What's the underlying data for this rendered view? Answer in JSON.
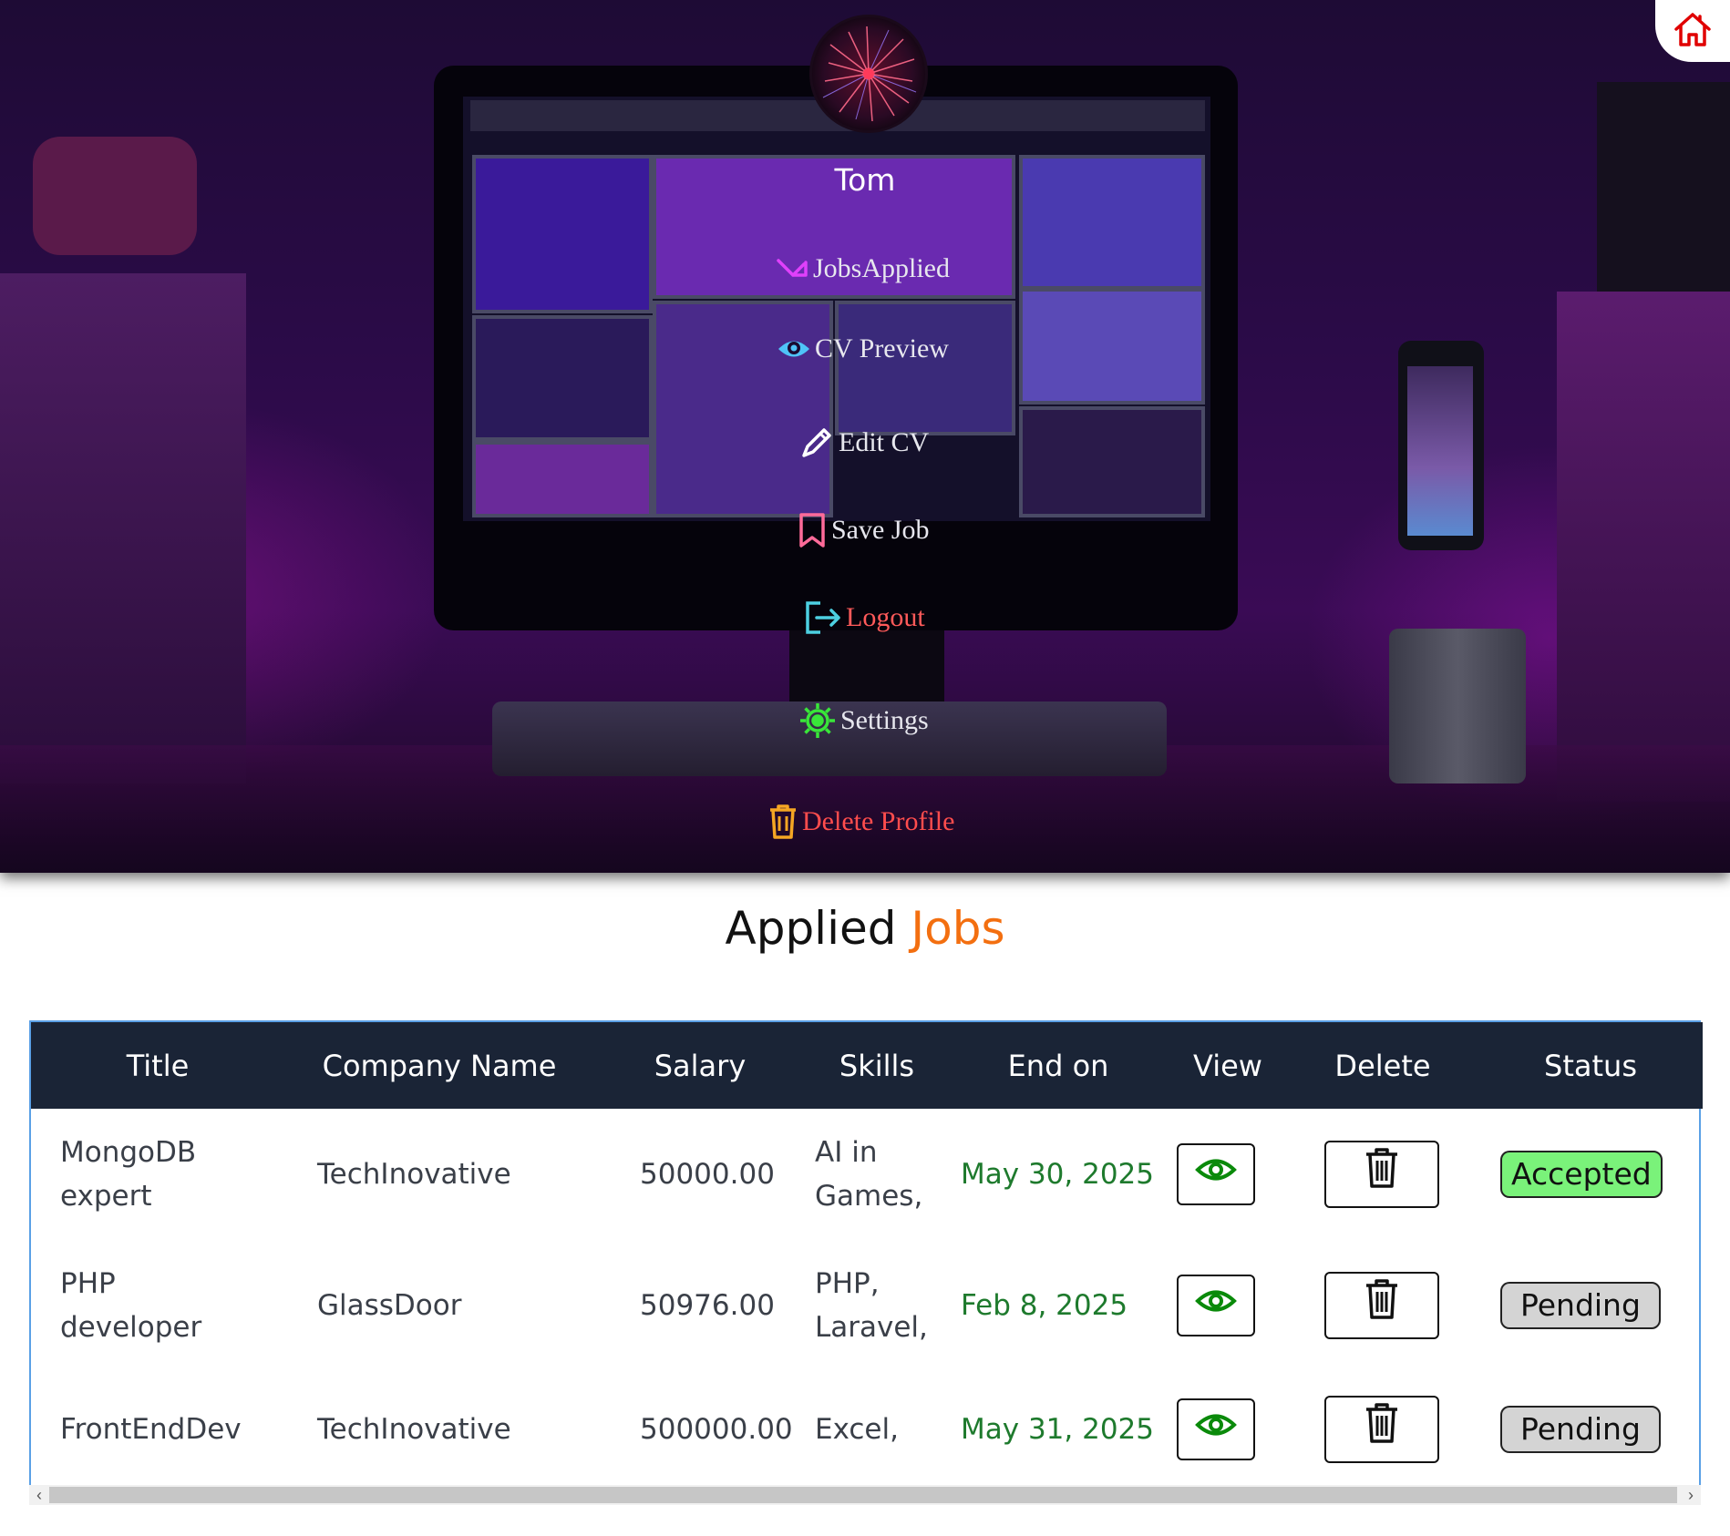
{
  "profile": {
    "name": "Tom"
  },
  "nav": {
    "jobs_applied": "JobsApplied",
    "cv_preview": "CV Preview",
    "edit_cv": "Edit CV",
    "save_job": "Save Job",
    "logout": "Logout",
    "settings": "Settings",
    "delete_profile": "Delete Profile"
  },
  "page": {
    "title_main": "Applied",
    "title_accent": "Jobs"
  },
  "table": {
    "headers": [
      "Title",
      "Company Name",
      "Salary",
      "Skills",
      "End on",
      "View",
      "Delete",
      "Status"
    ],
    "rows": [
      {
        "title": "MongoDB expert",
        "company": "TechInovative",
        "salary": "50000.00",
        "skills": "AI in Games,",
        "end_on": "May 30, 2025",
        "status": "Accepted"
      },
      {
        "title": "PHP developer",
        "company": "GlassDoor",
        "salary": "50976.00",
        "skills": "PHP, Laravel,",
        "end_on": "Feb 8, 2025",
        "status": "Pending"
      },
      {
        "title": "FrontEndDev",
        "company": "TechInovative",
        "salary": "500000.00",
        "skills": "Excel,",
        "end_on": "May 31, 2025",
        "status": "Pending"
      }
    ]
  },
  "colors": {
    "accent": "#f36f10",
    "table_header_bg": "#1a2436",
    "date_green": "#1e7a2d",
    "accepted_bg": "#7af27a",
    "pending_bg": "#d4d4d4",
    "nav_jobs_icon": "#e040fb",
    "nav_cv_icon": "#4fc3f7",
    "nav_save_icon": "#ff6b9a",
    "nav_logout_icon": "#4dd0e1",
    "nav_logout_text": "#ff5a5a",
    "nav_settings_icon": "#39e639",
    "nav_delete_icon": "#f5a623",
    "nav_delete_text": "#ff4d4d",
    "home_icon": "#e00000"
  },
  "icons": {
    "home": "home-icon",
    "jobs_applied": "arrow-down-right-icon",
    "cv_preview": "eye-icon",
    "edit_cv": "pencil-icon",
    "save_job": "bookmark-icon",
    "logout": "logout-icon",
    "settings": "gear-icon",
    "delete_profile": "trash-icon",
    "view": "eye-icon",
    "delete": "trash-icon"
  }
}
